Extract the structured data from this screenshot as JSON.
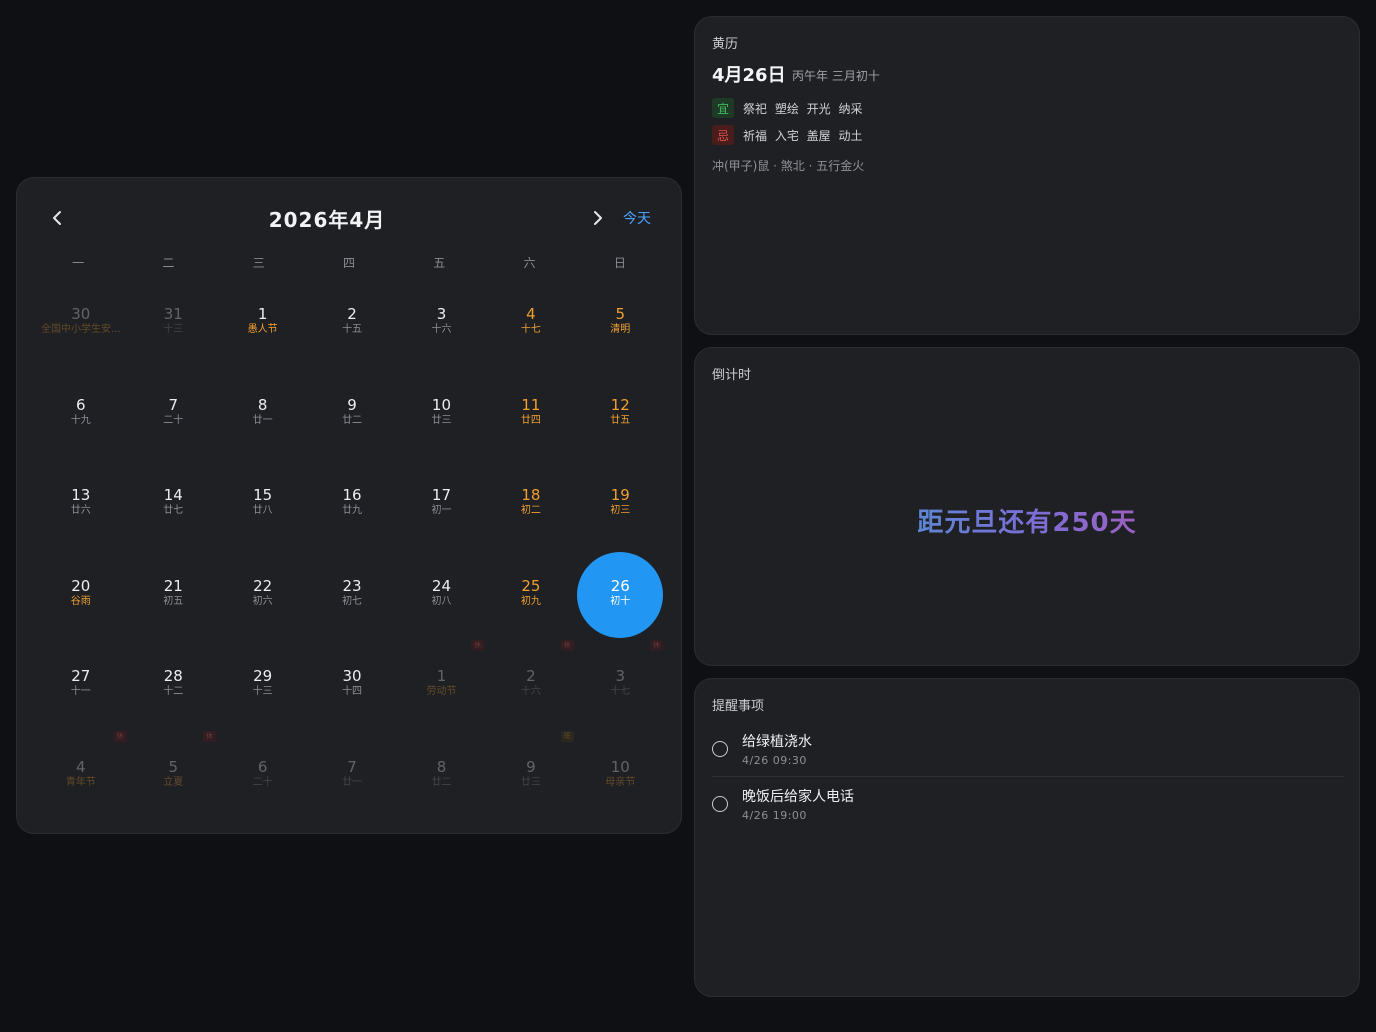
{
  "calendar": {
    "title": "2026年4月",
    "today_label": "今天",
    "weekdays": [
      "一",
      "二",
      "三",
      "四",
      "五",
      "六",
      "日"
    ],
    "days": [
      {
        "n": "30",
        "s": "全国中小学生安...",
        "other": true,
        "we": false,
        "hol": true
      },
      {
        "n": "31",
        "s": "十三",
        "other": true
      },
      {
        "n": "1",
        "s": "愚人节",
        "hol": true
      },
      {
        "n": "2",
        "s": "十五"
      },
      {
        "n": "3",
        "s": "十六"
      },
      {
        "n": "4",
        "s": "十七",
        "we": true
      },
      {
        "n": "5",
        "s": "清明",
        "we": true
      },
      {
        "n": "6",
        "s": "十九"
      },
      {
        "n": "7",
        "s": "二十"
      },
      {
        "n": "8",
        "s": "廿一"
      },
      {
        "n": "9",
        "s": "廿二"
      },
      {
        "n": "10",
        "s": "廿三"
      },
      {
        "n": "11",
        "s": "廿四",
        "we": true
      },
      {
        "n": "12",
        "s": "廿五",
        "we": true
      },
      {
        "n": "13",
        "s": "廿六"
      },
      {
        "n": "14",
        "s": "廿七"
      },
      {
        "n": "15",
        "s": "廿八"
      },
      {
        "n": "16",
        "s": "廿九"
      },
      {
        "n": "17",
        "s": "初一"
      },
      {
        "n": "18",
        "s": "初二",
        "we": true
      },
      {
        "n": "19",
        "s": "初三",
        "we": true
      },
      {
        "n": "20",
        "s": "谷雨",
        "hol": true
      },
      {
        "n": "21",
        "s": "初五"
      },
      {
        "n": "22",
        "s": "初六"
      },
      {
        "n": "23",
        "s": "初七"
      },
      {
        "n": "24",
        "s": "初八"
      },
      {
        "n": "25",
        "s": "初九",
        "we": true
      },
      {
        "n": "26",
        "s": "初十",
        "sel": true
      },
      {
        "n": "27",
        "s": "十一"
      },
      {
        "n": "28",
        "s": "十二"
      },
      {
        "n": "29",
        "s": "十三"
      },
      {
        "n": "30",
        "s": "十四"
      },
      {
        "n": "1",
        "s": "劳动节",
        "other": true,
        "hol": true,
        "badge": "休"
      },
      {
        "n": "2",
        "s": "十六",
        "other": true,
        "badge": "休"
      },
      {
        "n": "3",
        "s": "十七",
        "other": true,
        "badge": "休"
      },
      {
        "n": "4",
        "s": "青年节",
        "other": true,
        "hol": true,
        "badge": "休"
      },
      {
        "n": "5",
        "s": "立夏",
        "other": true,
        "hol": true,
        "badge": "休"
      },
      {
        "n": "6",
        "s": "二十",
        "other": true
      },
      {
        "n": "7",
        "s": "廿一",
        "other": true
      },
      {
        "n": "8",
        "s": "廿二",
        "other": true
      },
      {
        "n": "9",
        "s": "廿三",
        "other": true,
        "badge": "班",
        "work": true
      },
      {
        "n": "10",
        "s": "母亲节",
        "other": true,
        "hol": true
      }
    ]
  },
  "almanac": {
    "title": "黄历",
    "date": "4月26日",
    "lunar": "丙午年 三月初十",
    "yi_label": "宜",
    "yi_items": "祭祀 塑绘 开光 纳采",
    "ji_label": "忌",
    "ji_items": "祈福 入宅 盖屋 动土",
    "extra": "冲(甲子)鼠 · 煞北 · 五行金火"
  },
  "countdown": {
    "title": "倒计时",
    "text": "距元旦还有250天"
  },
  "reminders": {
    "title": "提醒事项",
    "items": [
      {
        "title": "给绿植浇水",
        "time": "4/26 09:30"
      },
      {
        "title": "晚饭后给家人电话",
        "time": "4/26 19:00"
      }
    ]
  },
  "colors": {
    "accent": "#2196f3",
    "weekend": "#f0a030",
    "link": "#4aa3ff",
    "yi": "#42b860",
    "ji": "#e05252"
  }
}
